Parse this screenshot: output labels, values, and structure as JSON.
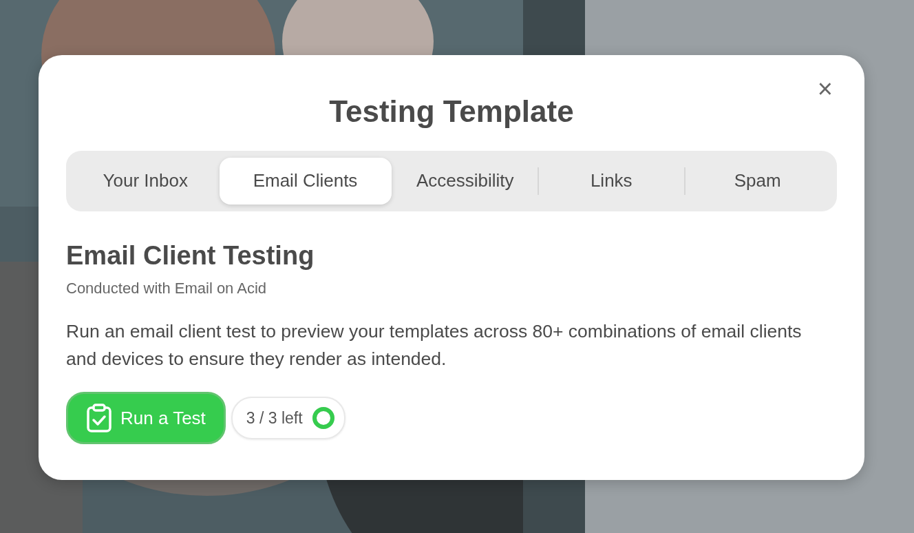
{
  "dialog": {
    "title": "Testing Template",
    "close": "×",
    "tabs": [
      {
        "label": "Your Inbox",
        "selected": false
      },
      {
        "label": "Email Clients",
        "selected": true
      },
      {
        "label": "Accessibility",
        "selected": false
      },
      {
        "label": "Links",
        "selected": false
      },
      {
        "label": "Spam",
        "selected": false
      }
    ],
    "section": {
      "title": "Email Client Testing",
      "subtitle": "Conducted with Email on Acid",
      "description": "Run an email client test to preview your templates across 80+ combinations of email clients and devices to ensure they render as intended."
    },
    "run_button": {
      "label": "Run a Test"
    },
    "quota": {
      "text": "3 / 3 left"
    }
  }
}
